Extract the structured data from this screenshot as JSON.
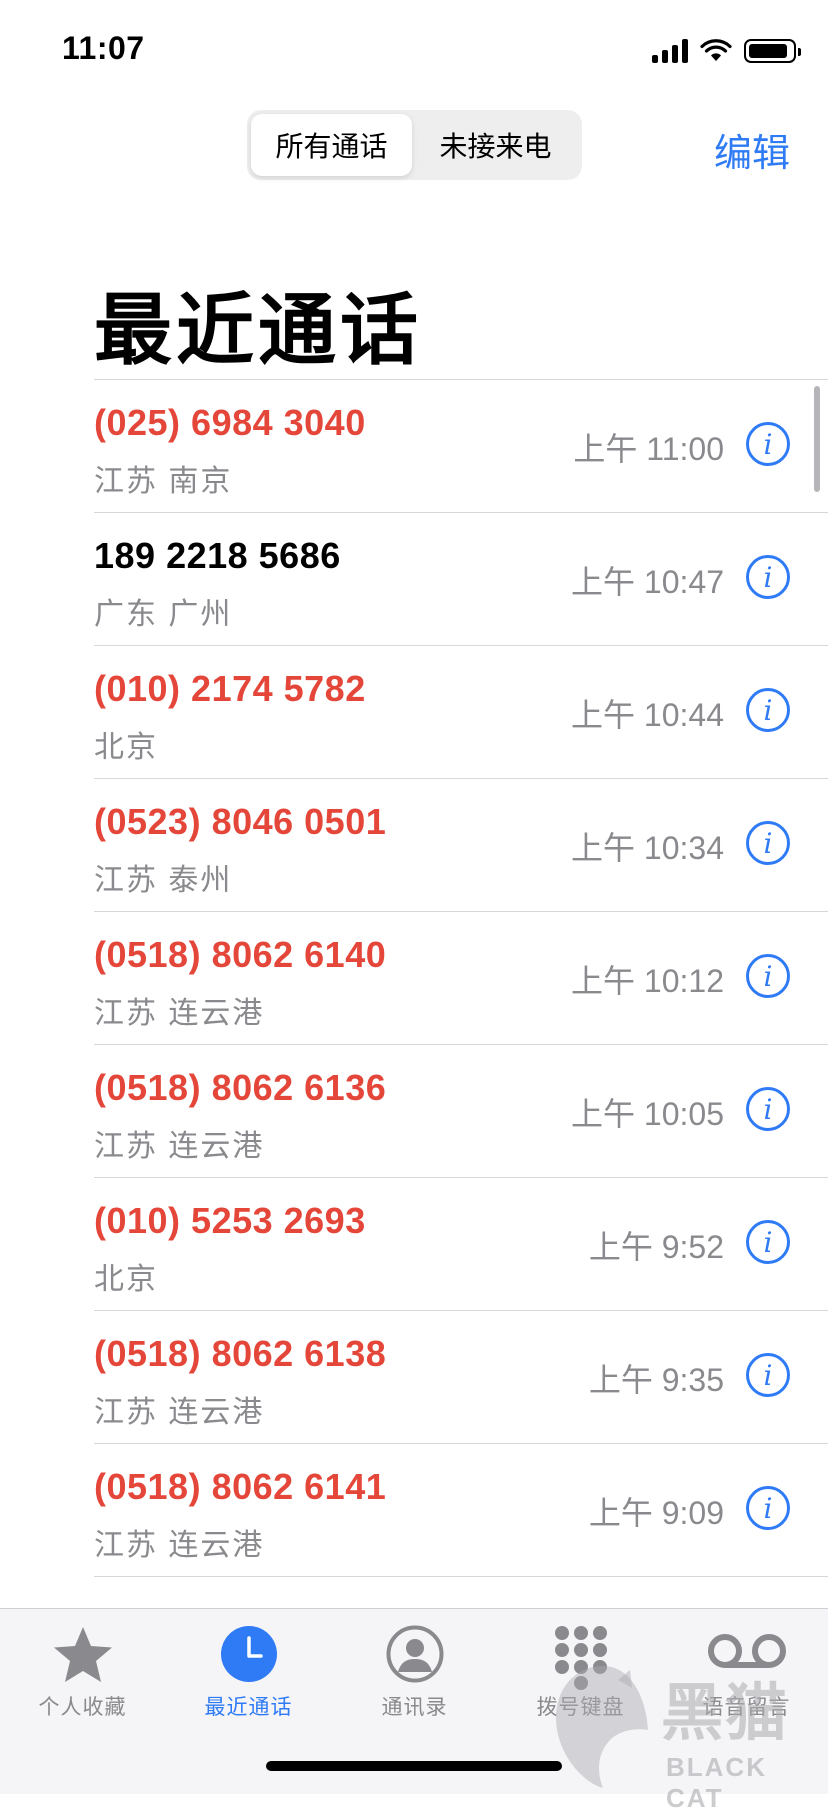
{
  "status_bar": {
    "time": "11:07"
  },
  "segmented_control": {
    "all_calls": "所有通话",
    "missed_calls": "未接来电"
  },
  "edit_label": "编辑",
  "page_title": "最近通话",
  "calls": [
    {
      "number": "(025) 6984 3040",
      "location": "江苏 南京",
      "time": "上午 11:00",
      "missed": true
    },
    {
      "number": "189 2218 5686",
      "location": "广东 广州",
      "time": "上午 10:47",
      "missed": false
    },
    {
      "number": "(010) 2174 5782",
      "location": "北京",
      "time": "上午 10:44",
      "missed": true
    },
    {
      "number": "(0523) 8046 0501",
      "location": "江苏 泰州",
      "time": "上午 10:34",
      "missed": true
    },
    {
      "number": "(0518) 8062 6140",
      "location": "江苏 连云港",
      "time": "上午 10:12",
      "missed": true
    },
    {
      "number": "(0518) 8062 6136",
      "location": "江苏 连云港",
      "time": "上午 10:05",
      "missed": true
    },
    {
      "number": "(010) 5253 2693",
      "location": "北京",
      "time": "上午 9:52",
      "missed": true
    },
    {
      "number": "(0518) 8062 6138",
      "location": "江苏 连云港",
      "time": "上午 9:35",
      "missed": true
    },
    {
      "number": "(0518) 8062 6141",
      "location": "江苏 连云港",
      "time": "上午 9:09",
      "missed": true
    }
  ],
  "tabs": [
    {
      "label": "个人收藏",
      "icon": "star-icon",
      "active": false
    },
    {
      "label": "最近通话",
      "icon": "clock-icon",
      "active": true
    },
    {
      "label": "通讯录",
      "icon": "contact-icon",
      "active": false
    },
    {
      "label": "拨号键盘",
      "icon": "keypad-icon",
      "active": false
    },
    {
      "label": "语音留言",
      "icon": "voicemail-icon",
      "active": false
    }
  ],
  "watermark": {
    "text": "黑猫",
    "subtext": "BLACK CAT"
  },
  "colors": {
    "accent": "#2f7bf6",
    "missed": "#e5463a",
    "secondary": "#8a8a8e"
  }
}
